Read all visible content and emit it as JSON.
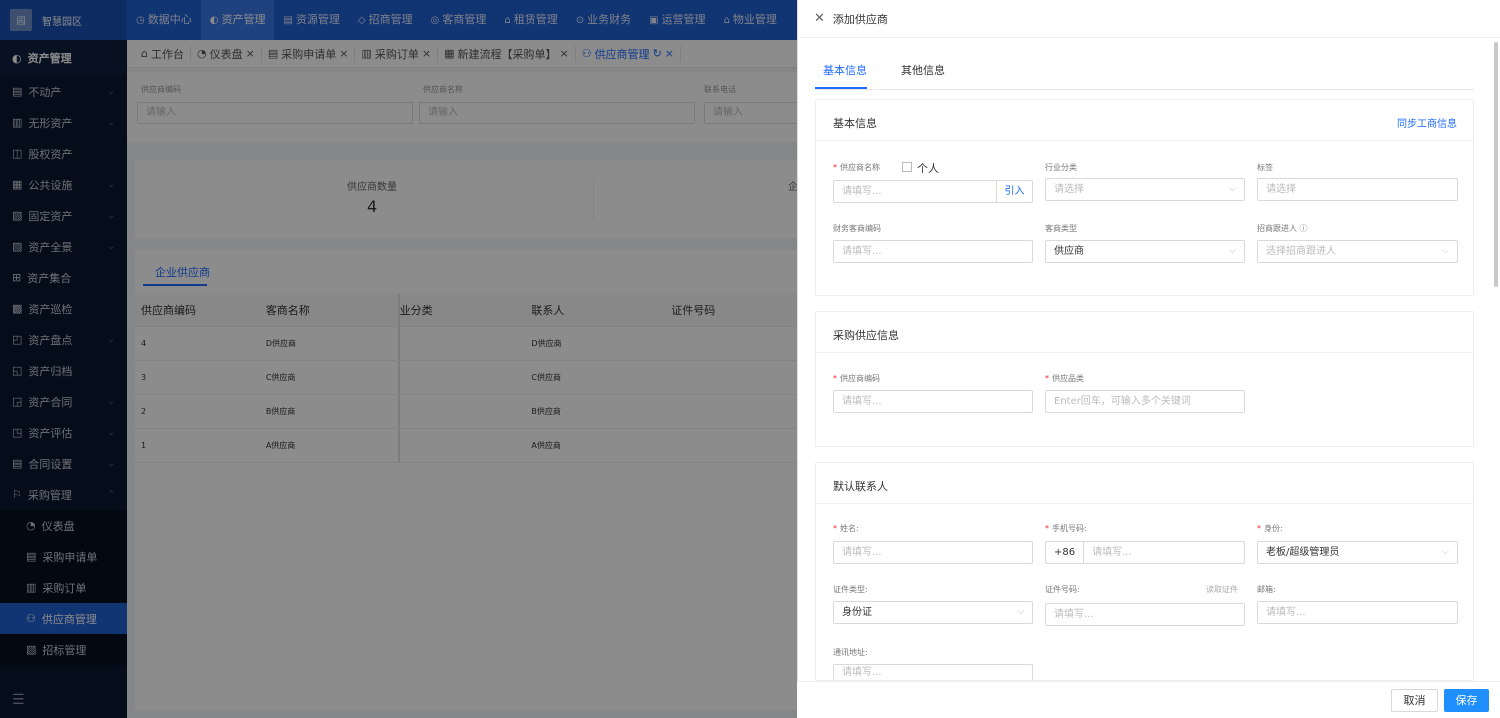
{
  "app": {
    "logo_text": "智慧园区",
    "logo_icon": "园"
  },
  "topnav": [
    {
      "icon": "◷",
      "label": "数据中心"
    },
    {
      "icon": "◐",
      "label": "资产管理"
    },
    {
      "icon": "▤",
      "label": "资源管理"
    },
    {
      "icon": "◇",
      "label": "招商管理"
    },
    {
      "icon": "◎",
      "label": "客商管理"
    },
    {
      "icon": "⌂",
      "label": "租赁管理"
    },
    {
      "icon": "⊙",
      "label": "业务财务"
    },
    {
      "icon": "▣",
      "label": "运营管理"
    },
    {
      "icon": "⌂",
      "label": "物业管理"
    }
  ],
  "sidebar": {
    "header": "资产管理",
    "items": [
      {
        "icon": "▤",
        "label": "不动产"
      },
      {
        "icon": "▥",
        "label": "无形资产"
      },
      {
        "icon": "◫",
        "label": "股权资产"
      },
      {
        "icon": "▦",
        "label": "公共设施"
      },
      {
        "icon": "▧",
        "label": "固定资产"
      },
      {
        "icon": "▨",
        "label": "资产全景"
      },
      {
        "icon": "⊞",
        "label": "资产集合"
      },
      {
        "icon": "▩",
        "label": "资产巡检"
      },
      {
        "icon": "◰",
        "label": "资产盘点"
      },
      {
        "icon": "◱",
        "label": "资产归档"
      },
      {
        "icon": "◲",
        "label": "资产合同"
      },
      {
        "icon": "◳",
        "label": "资产评估"
      },
      {
        "icon": "▤",
        "label": "合同设置"
      },
      {
        "icon": "⚐",
        "label": "采购管理"
      }
    ],
    "sub_items": [
      {
        "icon": "◔",
        "label": "仪表盘"
      },
      {
        "icon": "▤",
        "label": "采购申请单"
      },
      {
        "icon": "▥",
        "label": "采购订单"
      },
      {
        "icon": "⚇",
        "label": "供应商管理"
      },
      {
        "icon": "▧",
        "label": "招标管理"
      }
    ],
    "collapse_icon": "☰"
  },
  "tabs": [
    {
      "icon": "⌂",
      "label": "工作台"
    },
    {
      "icon": "◔",
      "label": "仪表盘"
    },
    {
      "icon": "▤",
      "label": "采购申请单"
    },
    {
      "icon": "▥",
      "label": "采购订单"
    },
    {
      "icon": "▦",
      "label": "新建流程【采购单】"
    },
    {
      "icon": "⚇",
      "label": "供应商管理"
    }
  ],
  "filters": [
    {
      "label": "供应商编码",
      "placeholder": "请输入"
    },
    {
      "label": "供应商名称",
      "placeholder": "请输入"
    },
    {
      "label": "联系电话",
      "placeholder": "请输入"
    }
  ],
  "stats": {
    "label": "供应商数量",
    "value": "4",
    "label2": "企"
  },
  "table": {
    "tab": "企业供应商",
    "headers": [
      "供应商编码",
      "客商名称",
      "业分类",
      "联系人",
      "证件号码"
    ],
    "rows": [
      [
        "4",
        "D供应商",
        "",
        "D供应商",
        ""
      ],
      [
        "3",
        "C供应商",
        "",
        "C供应商",
        ""
      ],
      [
        "2",
        "B供应商",
        "",
        "B供应商",
        ""
      ],
      [
        "1",
        "A供应商",
        "",
        "A供应商",
        ""
      ]
    ]
  },
  "drawer": {
    "title": "添加供应商",
    "tabs": [
      "基本信息",
      "其他信息"
    ],
    "basic": {
      "title": "基本信息",
      "sync_link": "同步工商信息",
      "supplier_name_label": "供应商名称",
      "personal_label": "个人",
      "supplier_name_placeholder": "请填写...",
      "import_btn": "引入",
      "industry_label": "行业分类",
      "industry_placeholder": "请选择",
      "tag_label": "标签",
      "tag_placeholder": "请选择",
      "finance_code_label": "财务客商编码",
      "finance_code_placeholder": "请填写...",
      "merchant_type_label": "客商类型",
      "merchant_type_value": "供应商",
      "follower_label": "招商跟进人 ⓘ",
      "follower_placeholder": "选择招商跟进人"
    },
    "purchase": {
      "title": "采购供应信息",
      "code_label": "供应商编码",
      "code_placeholder": "请填写...",
      "category_label": "供应品类",
      "category_placeholder": "Enter回车，可输入多个关键词"
    },
    "contact": {
      "title": "默认联系人",
      "name_label": "姓名:",
      "name_placeholder": "请填写...",
      "phone_label": "手机号码:",
      "phone_prefix": "+86",
      "phone_placeholder": "请填写...",
      "role_label": "身份:",
      "role_value": "老板/超级管理员",
      "id_type_label": "证件类型:",
      "id_type_value": "身份证",
      "id_no_label": "证件号码:",
      "read_id": "读取证件",
      "id_no_placeholder": "请填写...",
      "email_label": "邮箱:",
      "email_placeholder": "请填写...",
      "address_label": "通讯地址:",
      "address_placeholder": "请填写..."
    },
    "footer": {
      "cancel": "取消",
      "save": "保存"
    }
  }
}
